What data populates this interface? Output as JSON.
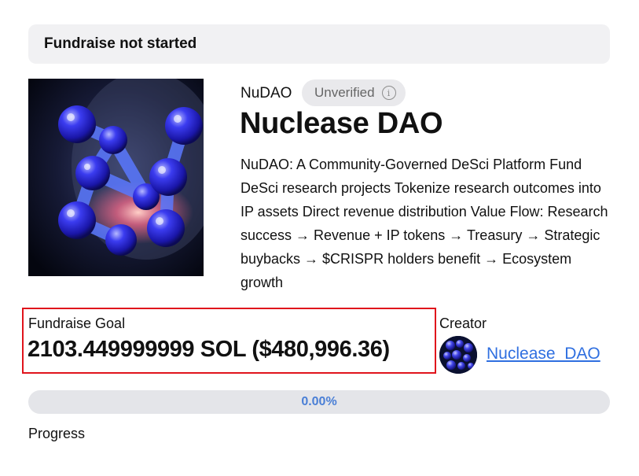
{
  "status": {
    "label": "Fundraise not started"
  },
  "project": {
    "ticker": "NuDAO",
    "verification": "Unverified",
    "name": "Nuclease DAO",
    "description": "NuDAO: A Community-Governed DeSci Platform Fund DeSci research projects Tokenize research outcomes into IP assets Direct revenue distribution Value Flow: Research success → Revenue + IP tokens → Treasury → Strategic buybacks → $CRISPR holders benefit → Ecosystem growth"
  },
  "fundraise": {
    "goal_label": "Fundraise Goal",
    "goal_value": "2103.449999999 SOL ($480,996.36)"
  },
  "creator": {
    "label": "Creator",
    "name": "Nuclease_DAO"
  },
  "progress": {
    "percent_text": "0.00%",
    "fraction": 0,
    "label": "Progress"
  },
  "colors": {
    "accent": "#2f6fe0",
    "highlight": "#e0141c",
    "panel": "#f1f1f3"
  },
  "icons": {
    "info": "info-icon"
  }
}
